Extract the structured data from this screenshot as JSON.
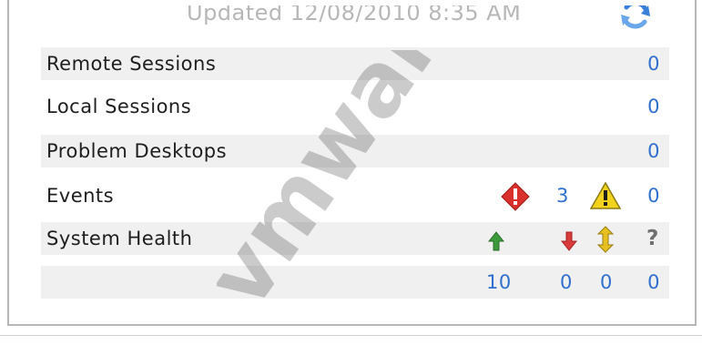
{
  "header": {
    "updated_text": "Updated 12/08/2010 8:35 AM",
    "refresh_icon": "refresh-icon"
  },
  "rows": [
    {
      "label": "Remote Sessions",
      "value": "0"
    },
    {
      "label": "Local Sessions",
      "value": "0"
    },
    {
      "label": "Problem Desktops",
      "value": "0"
    }
  ],
  "events": {
    "label": "Events",
    "error_icon": "error-diamond-icon",
    "error_count": "3",
    "warning_icon": "warning-triangle-icon",
    "warning_count": "0"
  },
  "system_health": {
    "label": "System Health",
    "icons": [
      "green-up-arrow-icon",
      "red-down-arrow-icon",
      "yellow-updown-arrow-icon",
      "unknown-icon"
    ],
    "unknown_symbol": "?",
    "counts": [
      "10",
      "0",
      "0",
      "0"
    ]
  },
  "watermark": "vmware",
  "colors": {
    "value_blue": "#2f6fce",
    "row_shade": "#f0f0f0",
    "up_green": "#3c9a3c",
    "down_red": "#d93a3a",
    "neutral_yellow": "#e6c020"
  }
}
